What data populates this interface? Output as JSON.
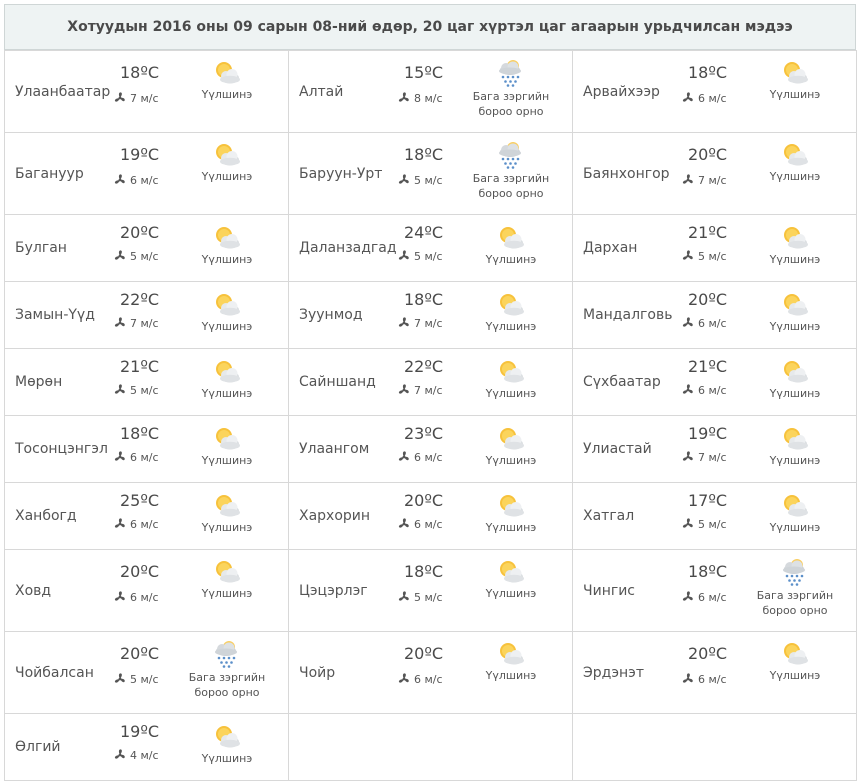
{
  "title": "Хотуудын 2016 оны 09 сарын 08-ний өдөр, 20 цаг хүртэл цаг агаарын урьдчилсан мэдээ",
  "wind_icon": "fan-icon",
  "rows": [
    [
      {
        "city": "Улаанбаатар",
        "temp": "18ºC",
        "wind": "7 м/с",
        "icon": "partly-cloudy-icon",
        "cond": "Үүлшинэ"
      },
      {
        "city": "Алтай",
        "temp": "15ºC",
        "wind": "8 м/с",
        "icon": "light-rain-icon",
        "cond": "Бага зэргийн бороо орно"
      },
      {
        "city": "Арвайхээр",
        "temp": "18ºC",
        "wind": "6 м/с",
        "icon": "partly-cloudy-icon",
        "cond": "Үүлшинэ"
      }
    ],
    [
      {
        "city": "Багануур",
        "temp": "19ºC",
        "wind": "6 м/с",
        "icon": "partly-cloudy-icon",
        "cond": "Үүлшинэ"
      },
      {
        "city": "Баруун-Урт",
        "temp": "18ºC",
        "wind": "5 м/с",
        "icon": "light-rain-icon",
        "cond": "Бага зэргийн бороо орно"
      },
      {
        "city": "Баянхонгор",
        "temp": "20ºC",
        "wind": "7 м/с",
        "icon": "partly-cloudy-icon",
        "cond": "Үүлшинэ"
      }
    ],
    [
      {
        "city": "Булган",
        "temp": "20ºC",
        "wind": "5 м/с",
        "icon": "partly-cloudy-icon",
        "cond": "Үүлшинэ"
      },
      {
        "city": "Даланзадгад",
        "temp": "24ºC",
        "wind": "5 м/с",
        "icon": "partly-cloudy-icon",
        "cond": "Үүлшинэ"
      },
      {
        "city": "Дархан",
        "temp": "21ºC",
        "wind": "5 м/с",
        "icon": "partly-cloudy-icon",
        "cond": "Үүлшинэ"
      }
    ],
    [
      {
        "city": "Замын-Үүд",
        "temp": "22ºC",
        "wind": "7 м/с",
        "icon": "partly-cloudy-icon",
        "cond": "Үүлшинэ"
      },
      {
        "city": "Зуунмод",
        "temp": "18ºC",
        "wind": "7 м/с",
        "icon": "partly-cloudy-icon",
        "cond": "Үүлшинэ"
      },
      {
        "city": "Мандалговь",
        "temp": "20ºC",
        "wind": "6 м/с",
        "icon": "partly-cloudy-icon",
        "cond": "Үүлшинэ"
      }
    ],
    [
      {
        "city": "Мөрөн",
        "temp": "21ºC",
        "wind": "5 м/с",
        "icon": "partly-cloudy-icon",
        "cond": "Үүлшинэ"
      },
      {
        "city": "Сайншанд",
        "temp": "22ºC",
        "wind": "7 м/с",
        "icon": "partly-cloudy-icon",
        "cond": "Үүлшинэ"
      },
      {
        "city": "Сүхбаатар",
        "temp": "21ºC",
        "wind": "6 м/с",
        "icon": "partly-cloudy-icon",
        "cond": "Үүлшинэ"
      }
    ],
    [
      {
        "city": "Тосонцэнгэл",
        "temp": "18ºC",
        "wind": "6 м/с",
        "icon": "partly-cloudy-icon",
        "cond": "Үүлшинэ"
      },
      {
        "city": "Улаангом",
        "temp": "23ºC",
        "wind": "6 м/с",
        "icon": "partly-cloudy-icon",
        "cond": "Үүлшинэ"
      },
      {
        "city": "Улиастай",
        "temp": "19ºC",
        "wind": "7 м/с",
        "icon": "partly-cloudy-icon",
        "cond": "Үүлшинэ"
      }
    ],
    [
      {
        "city": "Ханбогд",
        "temp": "25ºC",
        "wind": "6 м/с",
        "icon": "partly-cloudy-icon",
        "cond": "Үүлшинэ"
      },
      {
        "city": "Хархорин",
        "temp": "20ºC",
        "wind": "6 м/с",
        "icon": "partly-cloudy-icon",
        "cond": "Үүлшинэ"
      },
      {
        "city": "Хатгал",
        "temp": "17ºC",
        "wind": "5 м/с",
        "icon": "partly-cloudy-icon",
        "cond": "Үүлшинэ"
      }
    ],
    [
      {
        "city": "Ховд",
        "temp": "20ºC",
        "wind": "6 м/с",
        "icon": "partly-cloudy-icon",
        "cond": "Үүлшинэ"
      },
      {
        "city": "Цэцэрлэг",
        "temp": "18ºC",
        "wind": "5 м/с",
        "icon": "partly-cloudy-icon",
        "cond": "Үүлшинэ"
      },
      {
        "city": "Чингис",
        "temp": "18ºC",
        "wind": "6 м/с",
        "icon": "light-rain-icon",
        "cond": "Бага зэргийн бороо орно"
      }
    ],
    [
      {
        "city": "Чойбалсан",
        "temp": "20ºC",
        "wind": "5 м/с",
        "icon": "light-rain-icon",
        "cond": "Бага зэргийн бороо орно"
      },
      {
        "city": "Чойр",
        "temp": "20ºC",
        "wind": "6 м/с",
        "icon": "partly-cloudy-icon",
        "cond": "Үүлшинэ"
      },
      {
        "city": "Эрдэнэт",
        "temp": "20ºC",
        "wind": "6 м/с",
        "icon": "partly-cloudy-icon",
        "cond": "Үүлшинэ"
      }
    ],
    [
      {
        "city": "Өлгий",
        "temp": "19ºC",
        "wind": "4 м/с",
        "icon": "partly-cloudy-icon",
        "cond": "Үүлшинэ"
      },
      null,
      null
    ]
  ]
}
